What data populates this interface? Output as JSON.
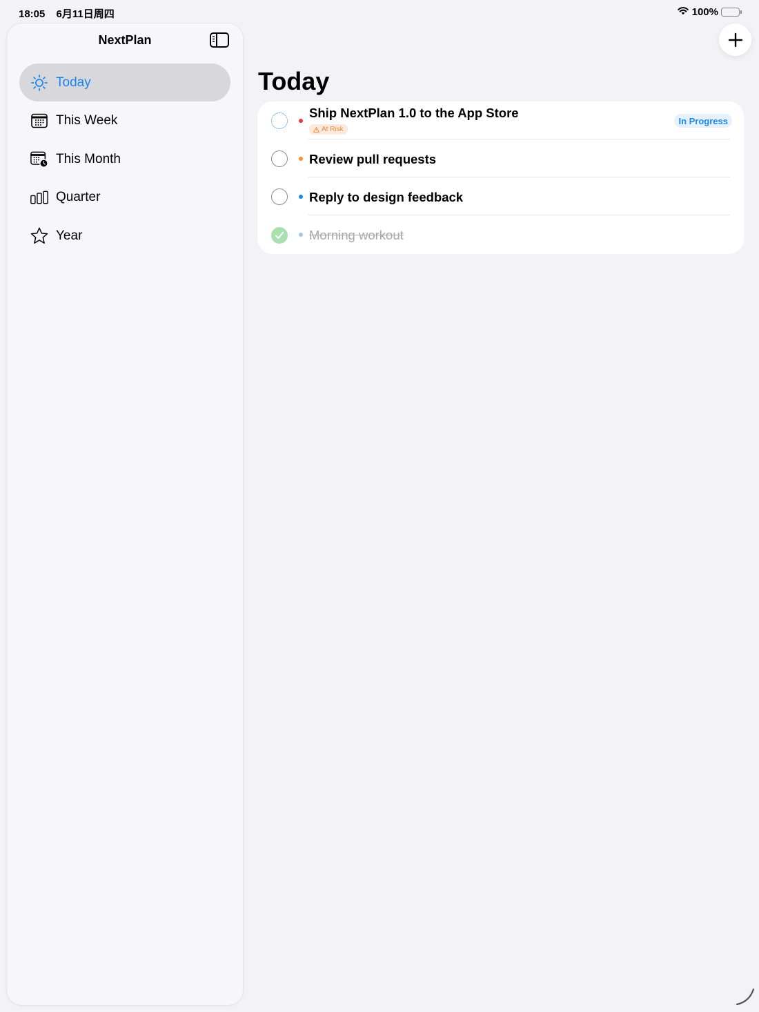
{
  "status_bar": {
    "time": "18:05",
    "date": "6月11日周四",
    "battery": "100%"
  },
  "sidebar": {
    "title": "NextPlan",
    "items": [
      {
        "label": "Today",
        "icon": "sun-icon",
        "active": true
      },
      {
        "label": "This Week",
        "icon": "calendar-icon",
        "active": false
      },
      {
        "label": "This Month",
        "icon": "calendar-clock-icon",
        "active": false
      },
      {
        "label": "Quarter",
        "icon": "bars-icon",
        "active": false
      },
      {
        "label": "Year",
        "icon": "star-icon",
        "active": false
      }
    ]
  },
  "main": {
    "title": "Today",
    "tasks": [
      {
        "title": "Ship NextPlan 1.0 to the App Store",
        "priority_color": "#f0353f",
        "state": "in-progress",
        "risk": "At Risk",
        "status": "In Progress"
      },
      {
        "title": "Review pull requests",
        "priority_color": "#f7902a",
        "state": "open"
      },
      {
        "title": "Reply to design feedback",
        "priority_color": "#1a87f0",
        "state": "open"
      },
      {
        "title": "Morning workout",
        "priority_color": "#9cc8f4",
        "state": "completed"
      }
    ]
  },
  "colors": {
    "accent": "#1a87f0",
    "background": "#f2f2f7",
    "done": "#a9e0b0",
    "risk": "#f08a3e"
  }
}
